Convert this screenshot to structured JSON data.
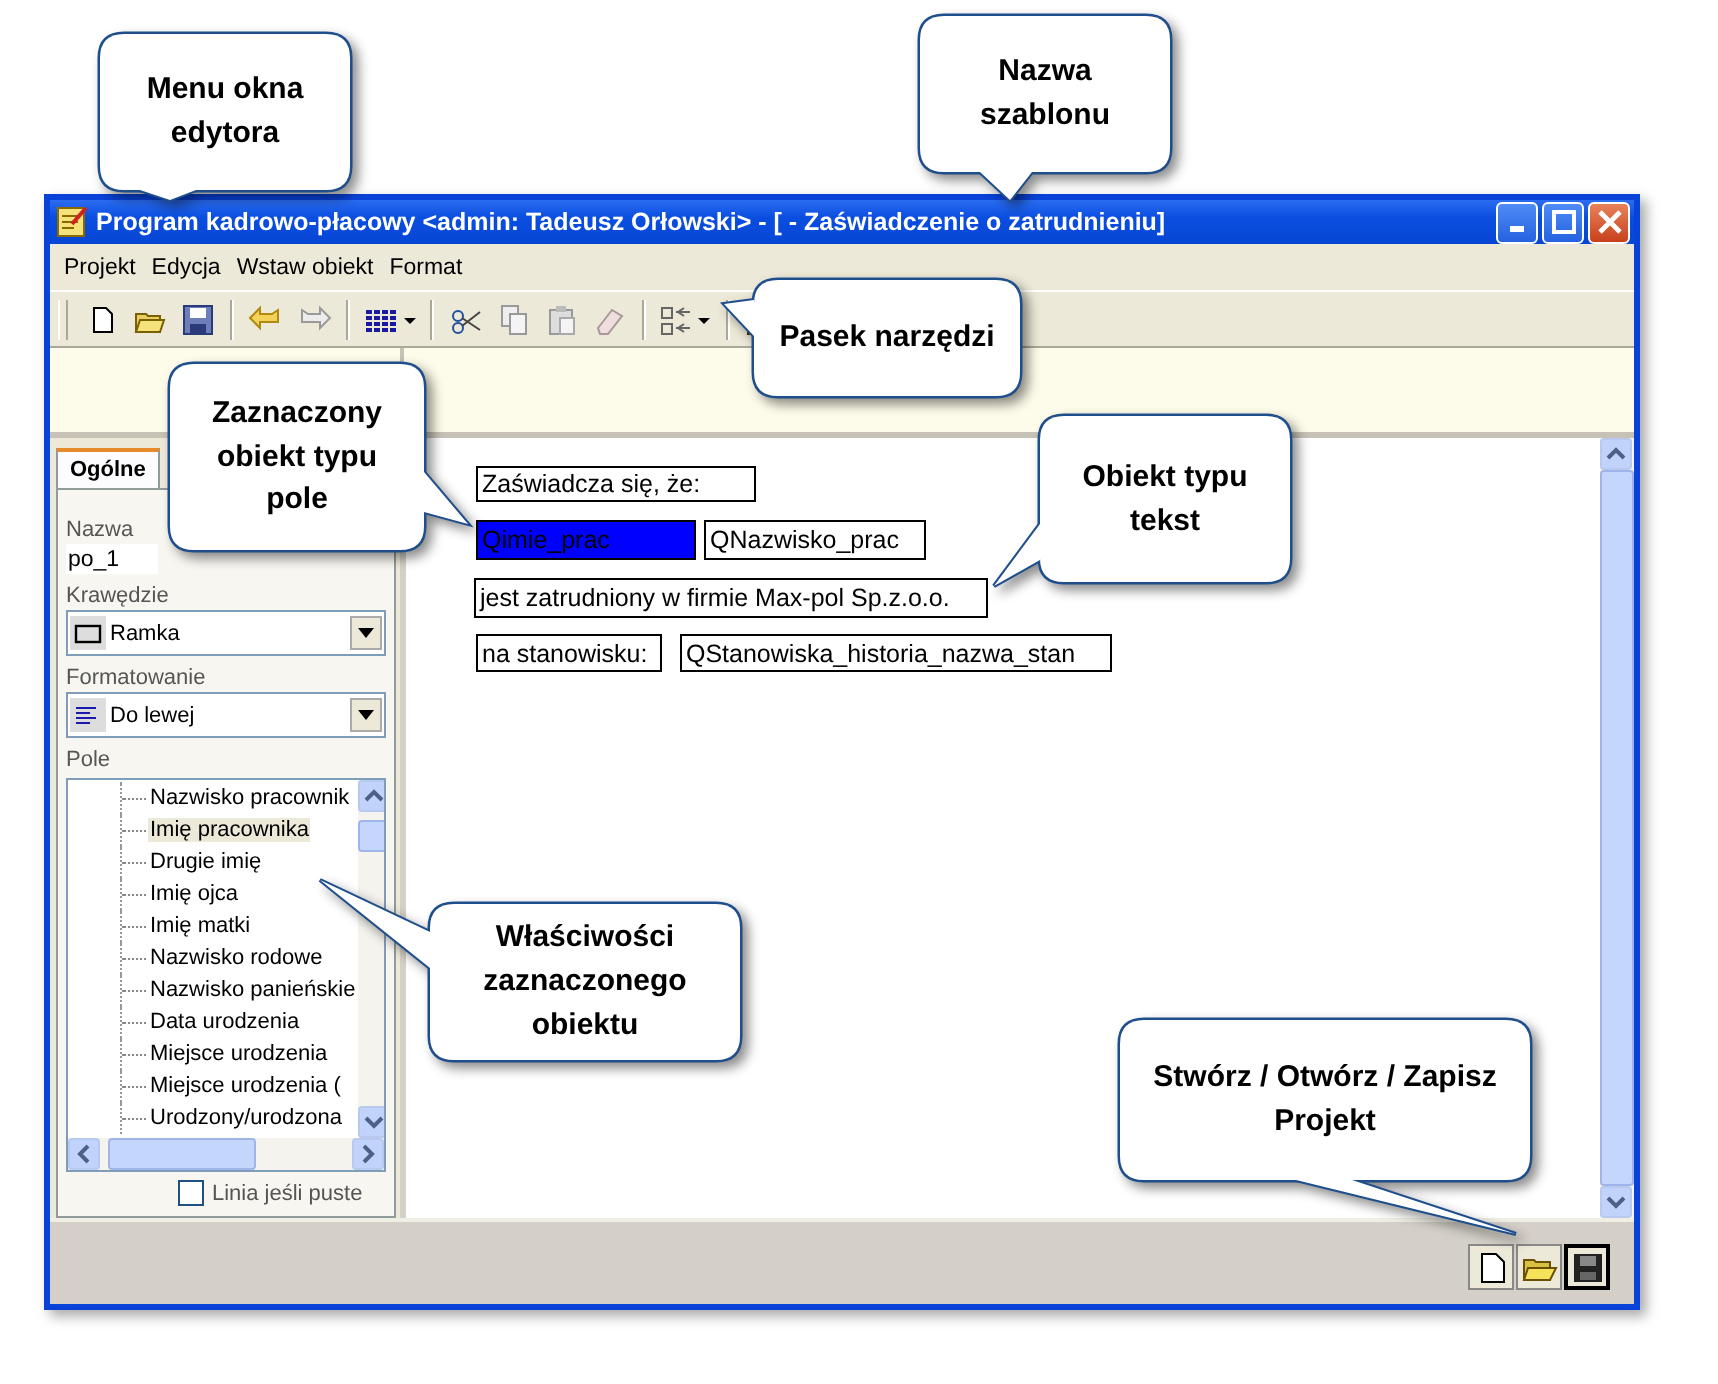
{
  "window": {
    "title": "Program kadrowo-płacowy <admin: Tadeusz Orłowski> - [ - Zaświadczenie o zatrudnieniu]"
  },
  "menu": [
    "Projekt",
    "Edycja",
    "Wstaw obiekt",
    "Format"
  ],
  "tabs": [
    {
      "label": "Ogólne",
      "selected": true
    }
  ],
  "properties": {
    "name_label": "Nazwa",
    "name_value": "po_1",
    "border_label": "Krawędzie",
    "border_value": "Ramka",
    "format_label": "Formatowanie",
    "format_value": "Do lewej",
    "field_label": "Pole",
    "fields": [
      {
        "label": "Nazwisko pracownik",
        "selected": false
      },
      {
        "label": "Imię pracownika",
        "selected": true
      },
      {
        "label": "Drugie imię",
        "selected": false
      },
      {
        "label": "Imię ojca",
        "selected": false
      },
      {
        "label": "Imię matki",
        "selected": false
      },
      {
        "label": "Nazwisko rodowe",
        "selected": false
      },
      {
        "label": "Nazwisko panieńskie",
        "selected": false
      },
      {
        "label": "Data urodzenia",
        "selected": false
      },
      {
        "label": "Miejsce urodzenia",
        "selected": false
      },
      {
        "label": "Miejsce urodzenia (",
        "selected": false
      },
      {
        "label": "Urodzony/urodzona",
        "selected": false
      }
    ],
    "blank_line": {
      "label": "Linia jeśli puste",
      "checked": false
    }
  },
  "canvas": {
    "objects": [
      {
        "text": "Zaświadcza się, że:",
        "selected": false
      },
      {
        "text": "Qimie_prac",
        "selected": true
      },
      {
        "text": "QNazwisko_prac",
        "selected": false
      },
      {
        "text": "jest zatrudniony w firmie Max-pol Sp.z.o.o.",
        "selected": false
      },
      {
        "text": "na stanowisku:",
        "selected": false
      },
      {
        "text": "QStanowiska_historia_nazwa_stan",
        "selected": false
      }
    ]
  },
  "callouts": [
    {
      "text": "Menu okna edytora"
    },
    {
      "text": "Nazwa szablonu"
    },
    {
      "text": "Pasek narzędzi"
    },
    {
      "text": "Zaznaczony obiekt typu pole"
    },
    {
      "text": "Obiekt typu tekst"
    },
    {
      "text": "Właściwości zaznaczonego obiektu"
    },
    {
      "text": "Stwórz / Otwórz / Zapisz Projekt"
    }
  ]
}
